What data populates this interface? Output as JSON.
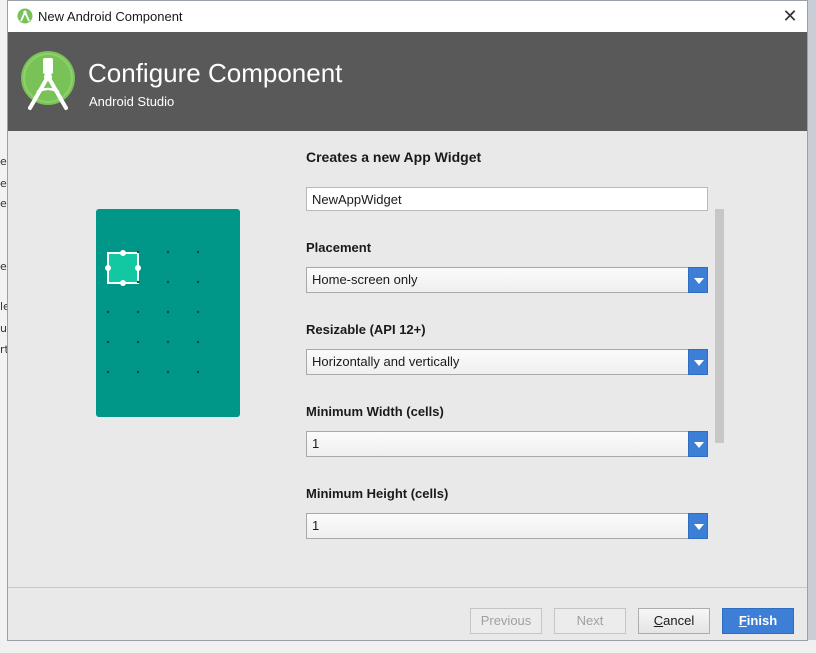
{
  "window": {
    "title": "New Android Component",
    "close_symbol": "✕"
  },
  "header": {
    "title": "Configure Component",
    "subtitle": "Android Studio"
  },
  "form": {
    "section_title": "Creates a new App Widget",
    "name_value": "NewAppWidget",
    "fields": [
      {
        "label": "Placement",
        "value": "Home-screen only"
      },
      {
        "label": "Resizable (API 12+)",
        "value": "Horizontally and vertically"
      },
      {
        "label": "Minimum Width (cells)",
        "value": "1"
      },
      {
        "label": "Minimum Height (cells)",
        "value": "1"
      }
    ]
  },
  "buttons": {
    "previous": "Previous",
    "next": "Next",
    "cancel_first": "C",
    "cancel_rest": "ancel",
    "finish_first": "F",
    "finish_rest": "inish"
  },
  "ide_fragments": [
    "e",
    "e",
    "e",
    "en",
    "le",
    "ul",
    "rt"
  ],
  "colors": {
    "header_bg": "#595959",
    "illustration_bg": "#009688",
    "accent_blue": "#3d7fd6",
    "android_green": "#78c257"
  },
  "icons": {
    "app_icon": "android-studio-icon",
    "logo": "android-studio-logo",
    "dropdown": "chevron-down-icon"
  }
}
